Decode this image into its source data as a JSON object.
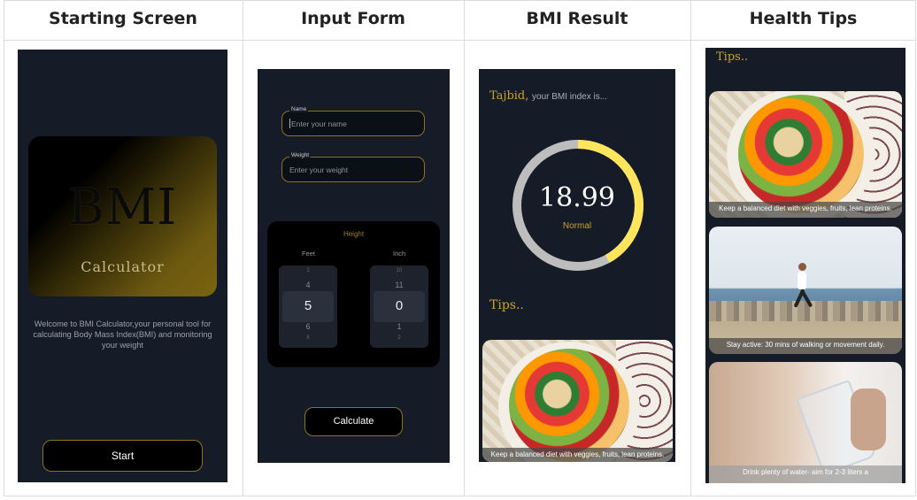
{
  "columns": [
    "Starting Screen",
    "Input Form",
    "BMI Result",
    "Health Tips"
  ],
  "start_screen": {
    "logo_title": "BMI",
    "logo_subtitle": "Calculator",
    "welcome_text": "Welcome to BMI Calculator,your personal tool for calculating Body Mass Index(BMI) and monitoring your weight",
    "start_button": "Start"
  },
  "input_form": {
    "name_label": "Name",
    "name_placeholder": "Enter your name",
    "weight_label": "Weight",
    "weight_placeholder": "Enter your weight",
    "height_title": "Height",
    "feet_label": "Feet",
    "inch_label": "Inch",
    "feet_values": [
      "3",
      "4",
      "5",
      "6",
      "6"
    ],
    "inch_values": [
      "10",
      "11",
      "0",
      "1",
      "2"
    ],
    "calculate_button": "Calculate"
  },
  "result": {
    "user_name": "Tajbid,",
    "intro": "your BMI index is...",
    "bmi_value": "18.99",
    "category": "Normal",
    "gauge_fraction": 0.42,
    "tips_heading": "Tips..",
    "tip_caption": "Keep a balanced diet with veggies, fruits, lean proteins."
  },
  "health_tips": {
    "heading": "Tips..",
    "tips": [
      "Keep a balanced diet with veggies, fruits, lean proteins.",
      "Stay active: 30 mins of walking or movement daily.",
      "Drink plenty of water- aim for 2-3 liters a"
    ]
  },
  "colors": {
    "screen_bg": "#161c27",
    "accent_gold": "#c9a227",
    "gauge_yellow": "#ffe55c",
    "gauge_grey": "#bdbdbd"
  }
}
